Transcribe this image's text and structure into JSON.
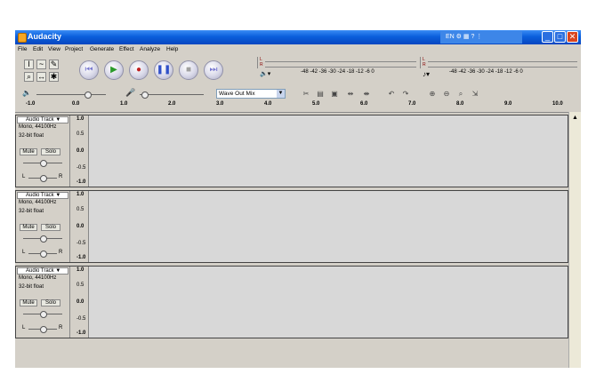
{
  "window": {
    "title": "Audacity",
    "tray_text": "EN"
  },
  "menu": [
    "File",
    "Edit",
    "View",
    "Project",
    "Generate",
    "Effect",
    "Analyze",
    "Help"
  ],
  "meters": {
    "record_scale": "-48  -42  -36  -30  -24  -18  -12   -6   0",
    "play_scale": "-48  -42  -36  -30  -24  -18  -12   -6   0",
    "lr_left": "L",
    "lr_right": "R"
  },
  "mixer": {
    "device": "Wave Out Mix"
  },
  "ruler": [
    "-1.0",
    "0.0",
    "1.0",
    "2.0",
    "3.0",
    "4.0",
    "5.0",
    "6.0",
    "7.0",
    "8.0",
    "9.0",
    "10.0"
  ],
  "tracks": [
    {
      "name": "Audio Track",
      "format": "Mono, 44100Hz",
      "bits": "32-bit float",
      "mute": "Mute",
      "solo": "Solo",
      "pan_l": "L",
      "pan_r": "R",
      "scale": [
        "1.0",
        "0.5",
        "0.0",
        "-0.5",
        "-1.0"
      ]
    },
    {
      "name": "Audio Track",
      "format": "Mono, 44100Hz",
      "bits": "32-bit float",
      "mute": "Mute",
      "solo": "Solo",
      "pan_l": "L",
      "pan_r": "R",
      "scale": [
        "1.0",
        "0.5",
        "0.0",
        "-0.5",
        "-1.0"
      ]
    },
    {
      "name": "Audio Track",
      "format": "Mono, 44100Hz",
      "bits": "32-bit float",
      "mute": "Mute",
      "solo": "Solo",
      "pan_l": "L",
      "pan_r": "R",
      "scale": [
        "1.0",
        "0.5",
        "0.0",
        "-0.5",
        "-1.0"
      ]
    }
  ],
  "colors": {
    "titlebar": "#0a5fdc",
    "window_bg": "#d4d0c8",
    "wave_bg": "#d8d8d8"
  }
}
